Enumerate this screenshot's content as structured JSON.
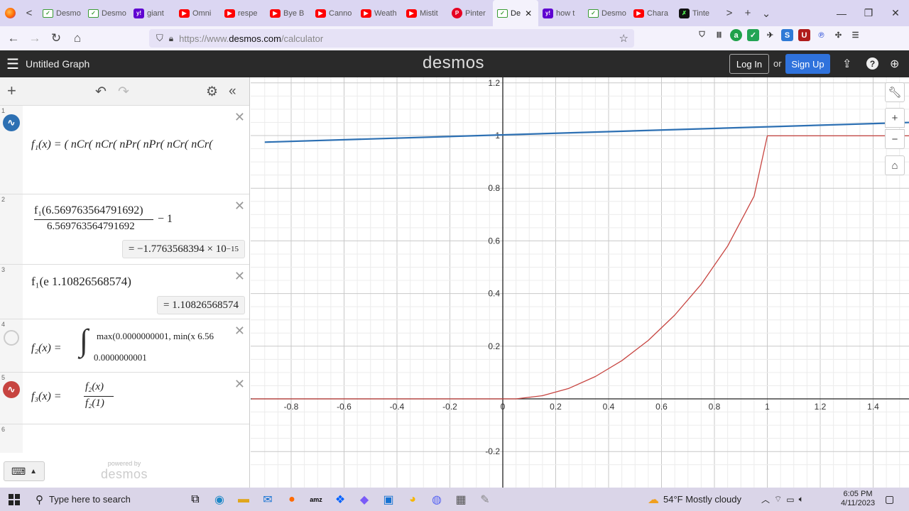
{
  "browser": {
    "tab_nav_left": "<",
    "tabs": [
      {
        "label": "Desmo",
        "icon": "desmos-favicon"
      },
      {
        "label": "Desmo",
        "icon": "desmos-favicon"
      },
      {
        "label": "giant",
        "icon": "yahoo-favicon"
      },
      {
        "label": "Omni",
        "icon": "youtube-favicon"
      },
      {
        "label": "respe",
        "icon": "youtube-favicon"
      },
      {
        "label": "Bye B",
        "icon": "youtube-favicon"
      },
      {
        "label": "Canno",
        "icon": "youtube-favicon"
      },
      {
        "label": "Weath",
        "icon": "youtube-favicon"
      },
      {
        "label": "Mistit",
        "icon": "youtube-favicon"
      },
      {
        "label": "Pinter",
        "icon": "pinterest-favicon"
      },
      {
        "label": "De",
        "icon": "desmos-favicon",
        "active": true
      },
      {
        "label": "how t",
        "icon": "yahoo-favicon"
      },
      {
        "label": "Desmo",
        "icon": "desmos-favicon"
      },
      {
        "label": "Chara",
        "icon": "youtube-favicon"
      },
      {
        "label": "Tinte",
        "icon": "tinted-favicon"
      }
    ],
    "tab_close": "✕",
    "more_tabs": ">",
    "new_tab": "+",
    "tab_list": "⌄",
    "url_prefix": "https://www.",
    "url_domain": "desmos.com",
    "url_path": "/calculator",
    "win_min": "—",
    "win_max": "❐",
    "win_close": "✕"
  },
  "header": {
    "menu_icon": "☰",
    "title": "Untitled Graph",
    "logo": "desmos",
    "login": "Log In",
    "or": "or",
    "signup": "Sign Up"
  },
  "expressions": [
    {
      "num": "1",
      "color": "#2d70b3",
      "latex_text": "f₁(x) = ( nCr( nCr( nPr( nPr( nCr( nCr("
    },
    {
      "num": "2",
      "numerator": "f₁(6.569763564791692)",
      "denominator": "6.569763564791692",
      "suffix": "− 1",
      "result_prefix": "= −1.7763568394 × 10",
      "result_exp": "−15"
    },
    {
      "num": "3",
      "text": "f₁(e 1.10826568574)",
      "result": "= 1.10826568574"
    },
    {
      "num": "4",
      "text_left": "f₂(x) =",
      "upper": "max(0.0000000001, min(x 6.56",
      "lower": "0.0000000001"
    },
    {
      "num": "5",
      "color": "#c74440",
      "lhs": "f₃(x) =",
      "num_expr": "f₂(x)",
      "den_expr": "f₂(1)"
    },
    {
      "num": "6"
    }
  ],
  "powered": {
    "line1": "powered by",
    "line2": "desmos"
  },
  "chart_data": {
    "type": "line",
    "xlim": [
      -0.95,
      1.55
    ],
    "ylim": [
      -0.265,
      1.22
    ],
    "x_ticks": [
      -0.8,
      -0.6,
      -0.4,
      -0.2,
      0,
      0.2,
      0.4,
      0.6,
      0.8,
      1,
      1.2,
      1.4
    ],
    "x_tick_labels": [
      "-0.8",
      "-0.6",
      "-0.4",
      "-0.2",
      "0",
      "0.2",
      "0.4",
      "0.6",
      "0.8",
      "1",
      "1.2",
      "1.4"
    ],
    "y_ticks": [
      -0.2,
      0.2,
      0.4,
      0.6,
      0.8,
      1,
      1.2
    ],
    "y_tick_labels": [
      "-0.2",
      "0.2",
      "0.4",
      "0.6",
      "0.8",
      "1",
      "1.2"
    ],
    "minor_grid_step": 0.05,
    "grid": true,
    "series": [
      {
        "color": "#2d70b3",
        "x": [
          -0.9,
          1.55
        ],
        "y": [
          0.975,
          1.05
        ]
      },
      {
        "color": "#c74440",
        "x": [
          -0.95,
          0.05,
          0.15,
          0.25,
          0.35,
          0.45,
          0.55,
          0.65,
          0.75,
          0.85,
          0.95,
          1.0,
          1.55
        ],
        "y": [
          0,
          0,
          0.012,
          0.04,
          0.085,
          0.145,
          0.222,
          0.318,
          0.435,
          0.58,
          0.77,
          0.999,
          0.999
        ]
      }
    ]
  },
  "taskbar": {
    "search_placeholder": "Type here to search",
    "weather": "54°F  Mostly cloudy",
    "time": "6:05 PM",
    "date": "4/11/2023"
  }
}
